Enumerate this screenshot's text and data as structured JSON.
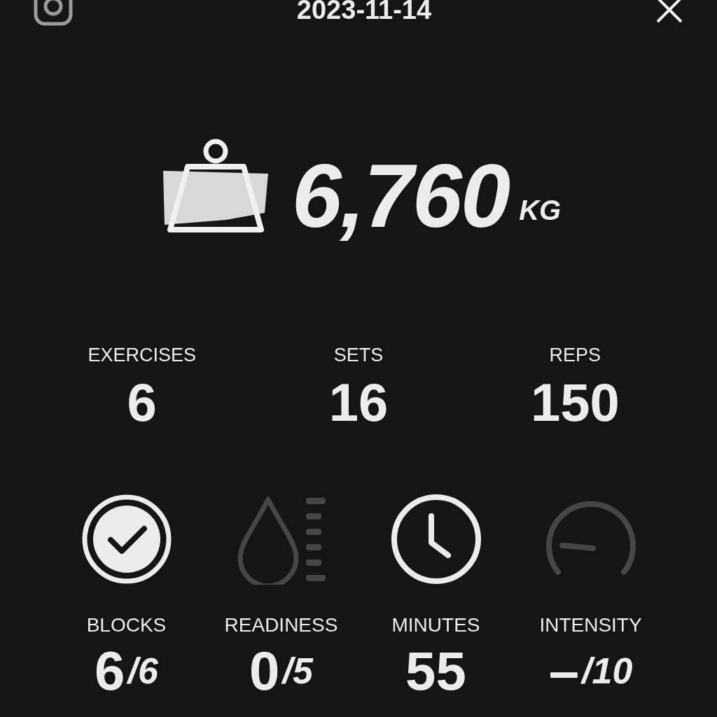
{
  "header": {
    "date": "2023-11-14"
  },
  "total": {
    "value": "6,760",
    "unit": "KG"
  },
  "stats": [
    {
      "label": "EXERCISES",
      "value": "6"
    },
    {
      "label": "SETS",
      "value": "16"
    },
    {
      "label": "REPS",
      "value": "150"
    }
  ],
  "metrics": [
    {
      "kind": "check",
      "active": true,
      "label": "BLOCKS",
      "value": "6",
      "total": "/6"
    },
    {
      "kind": "drop",
      "active": false,
      "label": "READINESS",
      "value": "0",
      "total": "/5"
    },
    {
      "kind": "clock",
      "active": true,
      "label": "MINUTES",
      "value": "55"
    },
    {
      "kind": "gauge",
      "active": false,
      "label": "INTENSITY",
      "value": "–",
      "total": "/10"
    }
  ]
}
